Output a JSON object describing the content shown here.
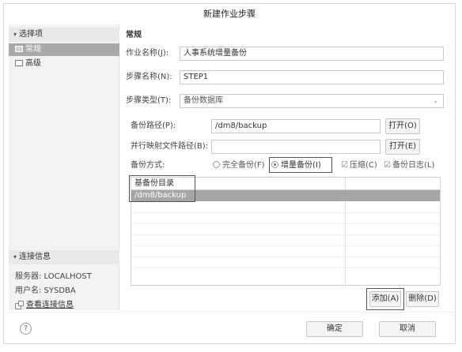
{
  "dialog": {
    "title": "新建作业步骤"
  },
  "sidebar": {
    "options_header": "选择项",
    "items": [
      {
        "label": "常规",
        "selected": true,
        "icon": "page-icon"
      },
      {
        "label": "高级",
        "selected": false,
        "icon": "page-icon"
      }
    ],
    "connection_header": "连接信息",
    "server": "服务器: LOCALHOST",
    "user": "用户名: SYSDBA",
    "view_link": "查看连接信息"
  },
  "main": {
    "section_title": "常规",
    "job_name_label": "作业名称(J):",
    "job_name_value": "人事系统增量备份",
    "step_name_label": "步骤名称(N):",
    "step_name_value": "STEP1",
    "step_type_label": "步骤类型(T):",
    "step_type_value": "备份数据库",
    "backup_path_label": "备份路径(P):",
    "backup_path_value": "/dm8/backup",
    "open_button_1": "打开(O)",
    "parallel_label": "并行映射文件路径(B):",
    "parallel_value": "",
    "open_button_2": "打开(E)",
    "method_label": "备份方式:",
    "full_backup": "完全备份(F)",
    "incremental_backup": "增量备份(I)",
    "compress": "压缩(C)",
    "backup_log": "备份日志(L)",
    "table": {
      "header": "基备份目录",
      "rows": [
        "/dm8/backup"
      ]
    },
    "add_button": "添加(A)",
    "delete_button": "删除(D)"
  },
  "footer": {
    "help_symbol": "?",
    "ok_button": "确定",
    "cancel_button": "取消"
  },
  "colors": {
    "selection": "#a9a9a9",
    "highlight_border": "#555555"
  }
}
